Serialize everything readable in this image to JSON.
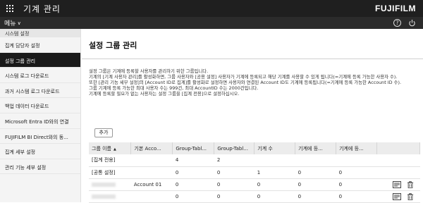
{
  "header": {
    "app_title": "기계 관리",
    "brand": "FUJIFILM"
  },
  "menubar": {
    "menu_label": "메뉴"
  },
  "sidebar": {
    "section_title": "시스템 설정",
    "items": [
      {
        "label": "집계 담당자 설정"
      },
      {
        "label": "설정 그룹 관리"
      },
      {
        "label": "시스템 로그 다운로드"
      },
      {
        "label": "과거 시스템 로그 다운로드"
      },
      {
        "label": "백업 데이터 다운로드"
      },
      {
        "label": "Microsoft Entra ID와의 연결"
      },
      {
        "label": "FUJIFILM BI Direct와의 동..."
      },
      {
        "label": "집계 세부 설정"
      },
      {
        "label": "관리 기능 세부 설정"
      }
    ]
  },
  "main": {
    "title": "설정 그룹 관리",
    "description": [
      "설정 그룹은 기계에 등록할 사용자를 관리하기 위한 그룹입니다.",
      "기계의 [기계 사용자 관리]를 활성화하면, 그룹 사용자와 [공용 설정] 사용자가 기계에 등록되고 해당 기계를 사용할 수 있게 됩니다(=기계에 등록 가능한 사용자 수).",
      "또한 [관리 기능 세부 설정]의 [Account ID로 집계]를 활성화로 설정하면 사용자와 연결된 Account ID도 기계에 등록됩니다(=기계에 등록 가능한 Account ID 수).",
      "그룹 기계에 등록 가능한 최대 사용자 수는 999건, 최대 AccountID 수는 2000건입니다.",
      "기계에 등록할 필요가 없는 사용자는 설정 그룹을 [집계 전용]으로 설정하십시오."
    ],
    "add_button": "추가",
    "table": {
      "headers": [
        "그룹 이름",
        "기본 Acco...",
        "Group-Tabl...",
        "Group-Tabl...",
        "기계 수",
        "기계에 등...",
        "기계에 등...",
        ""
      ],
      "rows": [
        [
          "[집계 전용]",
          "",
          "4",
          "2",
          "",
          "",
          "",
          ""
        ],
        [
          "[공통 설정]",
          "",
          "0",
          "0",
          "1",
          "0",
          "0",
          ""
        ],
        [
          "",
          "Account 01",
          "0",
          "0",
          "0",
          "0",
          "0",
          ""
        ],
        [
          "",
          "",
          "0",
          "0",
          "0",
          "0",
          "0",
          ""
        ]
      ]
    }
  }
}
